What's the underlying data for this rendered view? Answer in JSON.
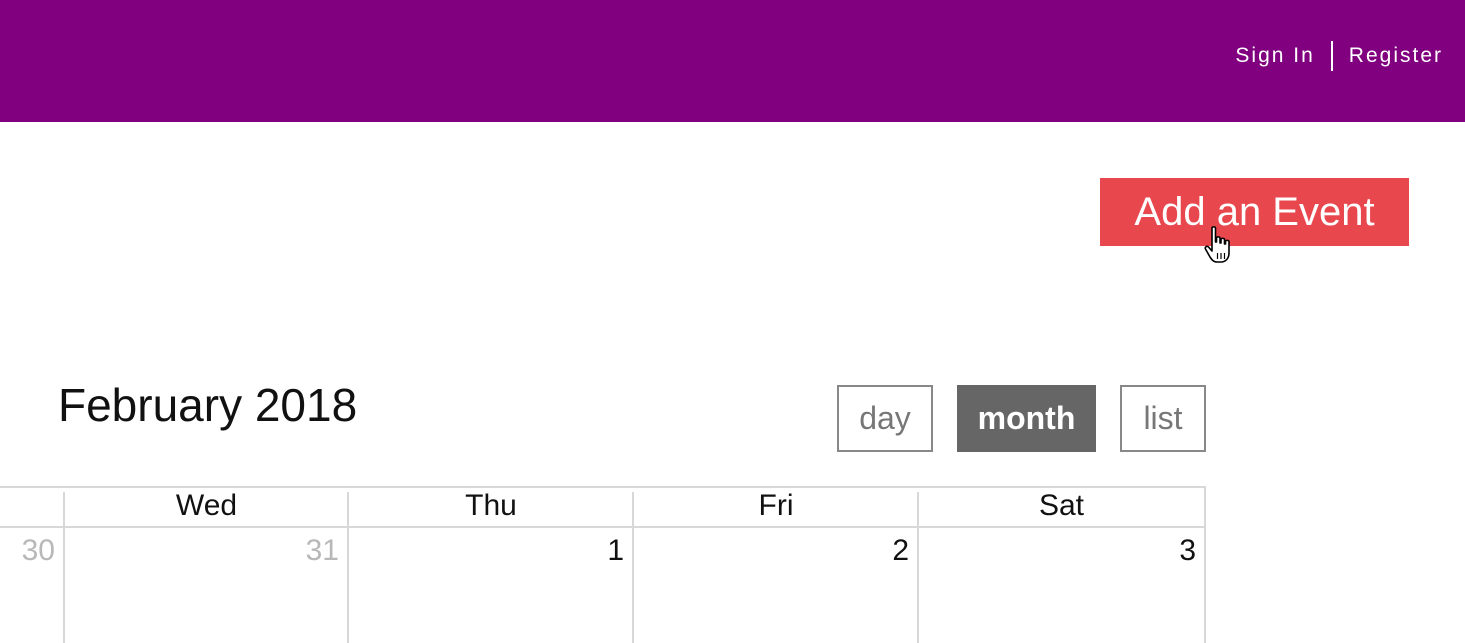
{
  "header": {
    "sign_in": "Sign In",
    "register": "Register",
    "background_color": "#800080"
  },
  "actions": {
    "add_event_label": "Add an Event",
    "add_event_color": "#e8474d"
  },
  "calendar": {
    "title": "February 2018",
    "views": [
      {
        "label": "day",
        "active": false
      },
      {
        "label": "month",
        "active": true
      },
      {
        "label": "list",
        "active": false
      }
    ],
    "weekday_headers": [
      "Wed",
      "Thu",
      "Fri",
      "Sat"
    ],
    "days": [
      {
        "label": "30",
        "other_month": true
      },
      {
        "label": "31",
        "other_month": true
      },
      {
        "label": "1",
        "other_month": false
      },
      {
        "label": "2",
        "other_month": false
      },
      {
        "label": "3",
        "other_month": false
      }
    ]
  }
}
